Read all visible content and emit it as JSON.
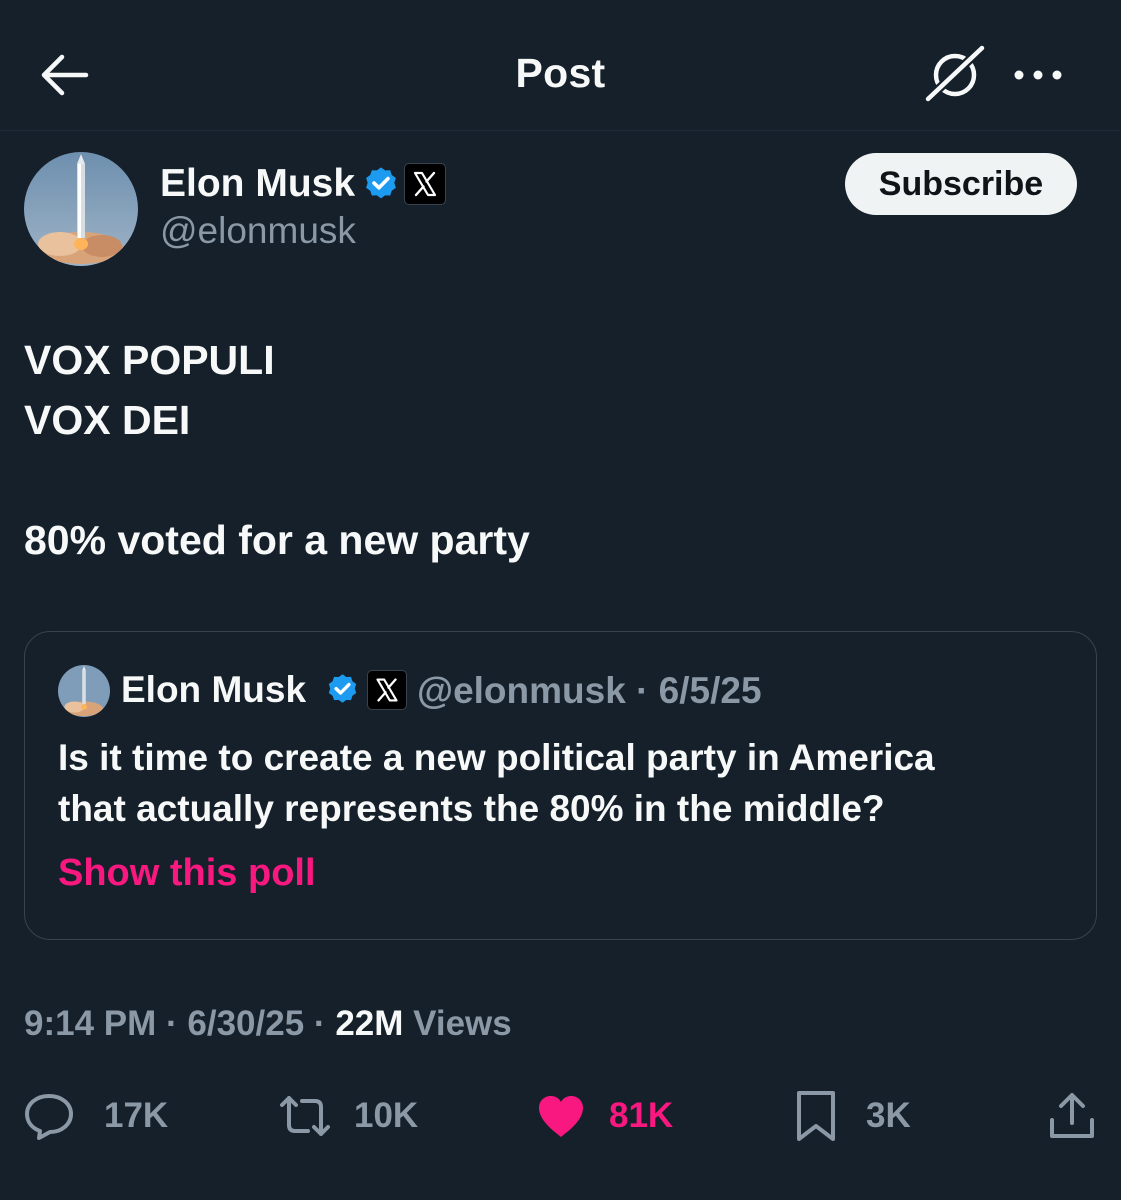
{
  "header": {
    "title": "Post"
  },
  "author": {
    "name": "Elon Musk",
    "handle": "@elonmusk",
    "subscribe_label": "Subscribe"
  },
  "post": {
    "lines": [
      "VOX POPULI",
      "VOX DEI",
      "",
      "80% voted for a new party"
    ]
  },
  "quote": {
    "author_name": "Elon Musk",
    "handle_date": "@elonmusk · 6/5/25",
    "text_lines": [
      "Is it time to create a new political party in America",
      "that actually represents the 80% in the middle?"
    ],
    "poll_link": "Show this poll"
  },
  "meta": {
    "time": "9:14 PM",
    "separator": "·",
    "date": "6/30/25",
    "views_count": "22M",
    "views_label": "Views"
  },
  "actions": {
    "replies": "17K",
    "reposts": "10K",
    "likes": "81K",
    "bookmarks": "3K"
  },
  "colors": {
    "background": "#15202b",
    "primary_text": "#f7f9f9",
    "secondary_text": "#8b98a5",
    "accent_pink": "#f91880",
    "verified_blue": "#1d9bf0",
    "border": "#38444d"
  },
  "icons": {
    "back": "arrow-left-icon",
    "grok": "grok-icon",
    "more": "more-horizontal-icon",
    "verified": "verified-badge-icon",
    "affiliate": "x-logo-icon",
    "reply": "reply-icon",
    "repost": "repost-icon",
    "like": "heart-icon",
    "bookmark": "bookmark-icon",
    "share": "share-icon"
  }
}
